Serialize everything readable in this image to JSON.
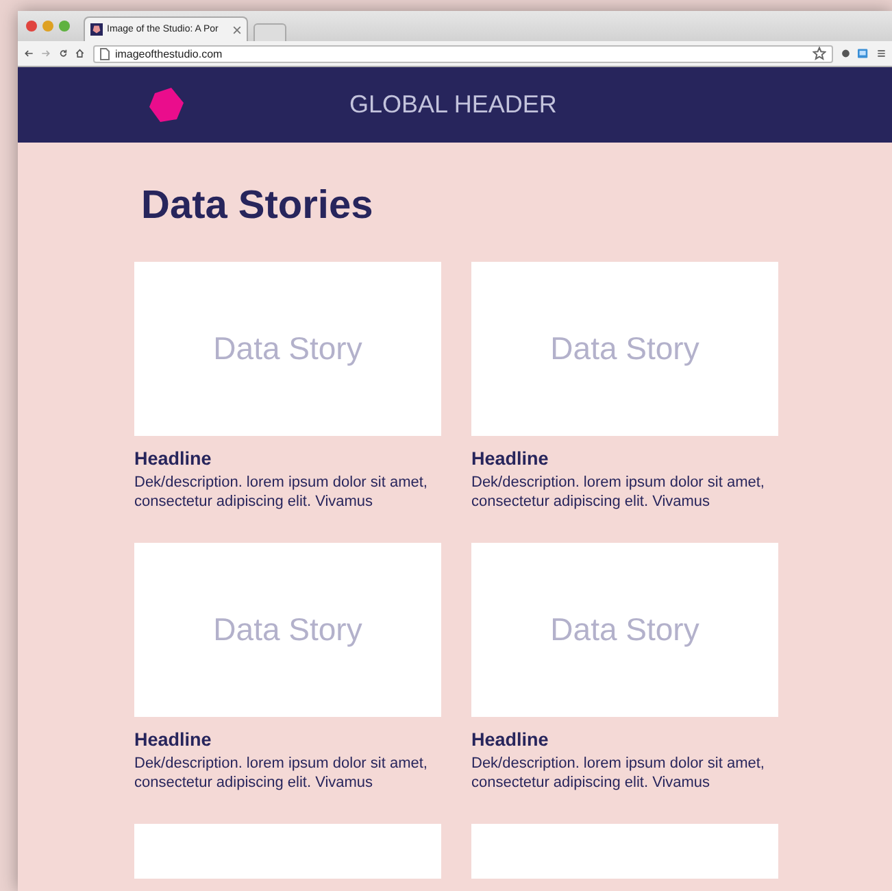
{
  "browser": {
    "tab_title": "Image of the Studio: A Por",
    "url": "imageofthestudio.com"
  },
  "header": {
    "title": "GLOBAL HEADER"
  },
  "page_title": "Data Stories",
  "cards": [
    {
      "image_label": "Data Story",
      "headline": "Headline",
      "description": "Dek/description. lorem ipsum dolor sit amet, consectetur adipiscing elit. Vivamus"
    },
    {
      "image_label": "Data Story",
      "headline": "Headline",
      "description": "Dek/description. lorem ipsum dolor sit amet, consectetur adipiscing elit. Vivamus"
    },
    {
      "image_label": "Data Story",
      "headline": "Headline",
      "description": "Dek/description. lorem ipsum dolor sit amet, consectetur adipiscing elit. Vivamus"
    },
    {
      "image_label": "Data Story",
      "headline": "Headline",
      "description": "Dek/description. lorem ipsum dolor sit amet, consectetur adipiscing elit. Vivamus"
    },
    {
      "kind": "cut"
    },
    {
      "kind": "cut"
    }
  ]
}
